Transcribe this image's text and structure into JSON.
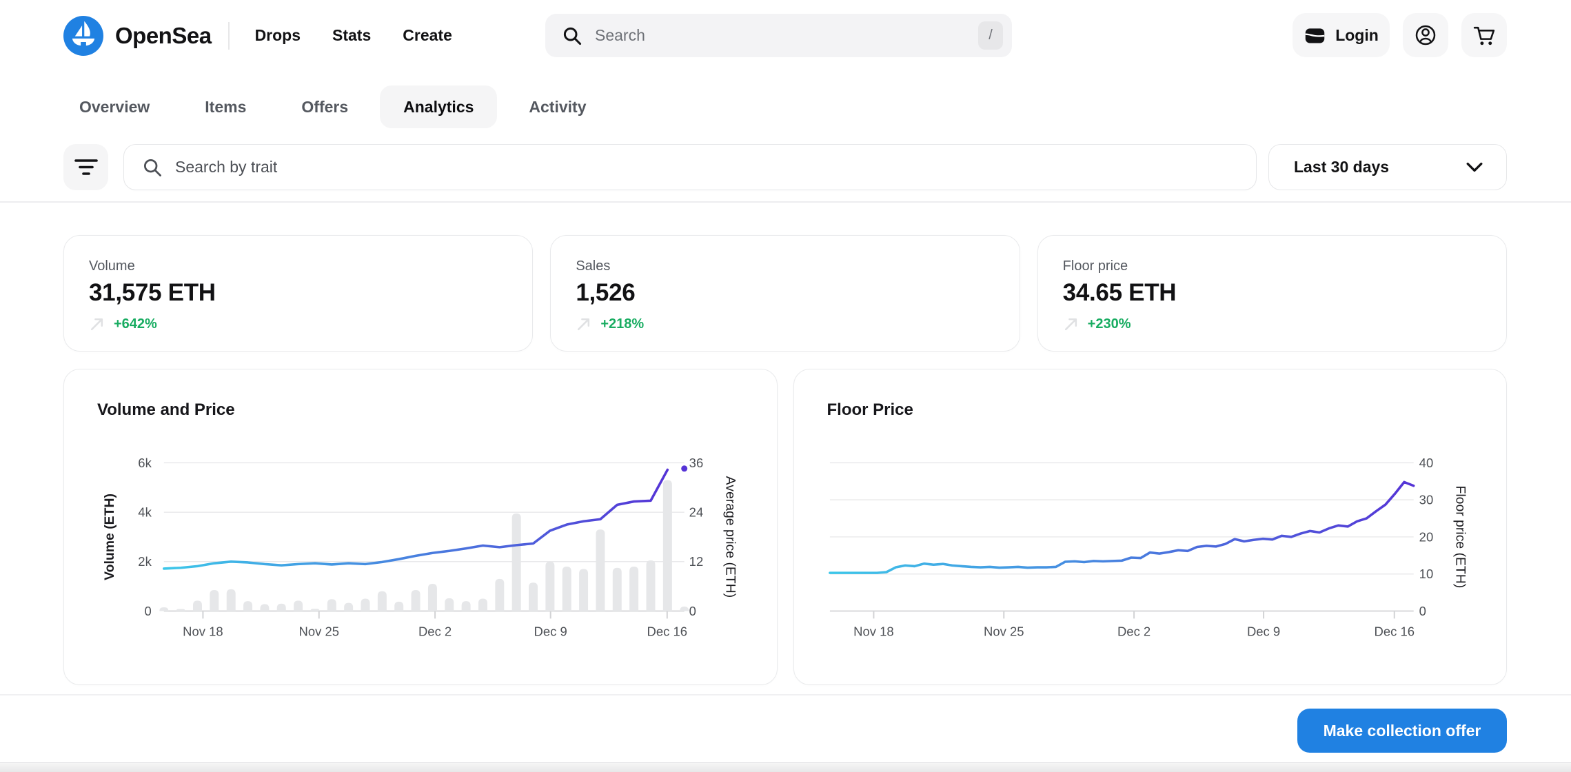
{
  "header": {
    "brand": "OpenSea",
    "nav": [
      {
        "label": "Drops"
      },
      {
        "label": "Stats"
      },
      {
        "label": "Create"
      }
    ],
    "search": {
      "placeholder": "Search",
      "shortcut": "/"
    },
    "login_label": "Login"
  },
  "tabs": [
    {
      "label": "Overview",
      "active": false
    },
    {
      "label": "Items",
      "active": false
    },
    {
      "label": "Offers",
      "active": false
    },
    {
      "label": "Analytics",
      "active": true
    },
    {
      "label": "Activity",
      "active": false
    }
  ],
  "filters": {
    "trait_search_placeholder": "Search by trait",
    "time_range": "Last 30 days"
  },
  "stats": [
    {
      "label": "Volume",
      "value": "31,575 ETH",
      "change": "+642%"
    },
    {
      "label": "Sales",
      "value": "1,526",
      "change": "+218%"
    },
    {
      "label": "Floor price",
      "value": "34.65 ETH",
      "change": "+230%"
    }
  ],
  "footer": {
    "offer_button": "Make collection offer"
  },
  "icons": {
    "logo": "opensea-boat",
    "search": "magnifier",
    "login": "wallet",
    "account": "user-circle",
    "cart": "shopping-cart",
    "filter": "filter-lines",
    "dropdown": "chevron-down",
    "change": "arrow-up-right"
  },
  "colors": {
    "accent_blue": "#2081E2",
    "green": "#18AC61",
    "bar_fill": "#e6e7e9",
    "line_gradient": [
      "#3DC7E9",
      "#4880DF",
      "#5533D6"
    ]
  },
  "chart_data": [
    {
      "type": "bar",
      "title": "Volume and Price",
      "x_ticks": [
        "Nov 18",
        "Nov 25",
        "Dec 2",
        "Dec 9",
        "Dec 16"
      ],
      "left_axis": {
        "label": "Volume (ETH)",
        "ticks": [
          "0",
          "2k",
          "4k",
          "6k"
        ],
        "range": [
          0,
          6000
        ]
      },
      "right_axis": {
        "label": "Average price (ETH)",
        "ticks": [
          "0",
          "12",
          "24",
          "36"
        ],
        "range": [
          0,
          36
        ]
      },
      "legend": "off",
      "grid": "horizontal",
      "bars": {
        "name": "Volume (ETH)",
        "axis": "left",
        "values": [
          150,
          80,
          420,
          850,
          880,
          400,
          280,
          300,
          420,
          90,
          480,
          330,
          500,
          800,
          380,
          850,
          1100,
          520,
          400,
          500,
          1300,
          3950,
          1150,
          2000,
          1800,
          1700,
          3300,
          1750,
          1800,
          2050,
          5300,
          180
        ]
      },
      "line": {
        "name": "Average price (ETH)",
        "axis": "right",
        "end_dot": true,
        "values": [
          10.3,
          10.5,
          10.9,
          11.6,
          12.0,
          11.8,
          11.4,
          11.1,
          11.4,
          11.6,
          11.3,
          11.6,
          11.4,
          11.9,
          12.6,
          13.4,
          14.1,
          14.6,
          15.2,
          15.9,
          15.5,
          16.0,
          16.4,
          19.5,
          21.0,
          21.8,
          22.3,
          25.8,
          26.6,
          26.8,
          34.3,
          34.6
        ]
      }
    },
    {
      "type": "line",
      "title": "Floor Price",
      "x_ticks": [
        "Nov 18",
        "Nov 25",
        "Dec 2",
        "Dec 9",
        "Dec 16"
      ],
      "right_axis": {
        "label": "Floor price (ETH)",
        "ticks": [
          "0",
          "10",
          "20",
          "30",
          "40"
        ],
        "range": [
          0,
          40
        ]
      },
      "legend": "off",
      "grid": "horizontal",
      "line": {
        "name": "Floor price (ETH)",
        "axis": "right",
        "end_dot": false,
        "values": [
          10.3,
          10.3,
          10.3,
          10.3,
          10.3,
          10.3,
          10.5,
          11.8,
          12.3,
          12.1,
          12.8,
          12.5,
          12.7,
          12.3,
          12.1,
          11.9,
          11.8,
          11.9,
          11.7,
          11.8,
          11.9,
          11.7,
          11.8,
          11.8,
          11.9,
          13.3,
          13.4,
          13.2,
          13.5,
          13.4,
          13.5,
          13.6,
          14.4,
          14.3,
          15.8,
          15.5,
          15.9,
          16.4,
          16.2,
          17.3,
          17.6,
          17.4,
          18.1,
          19.4,
          18.8,
          19.2,
          19.5,
          19.3,
          20.3,
          20.0,
          20.9,
          21.6,
          21.2,
          22.3,
          23.1,
          22.8,
          24.2,
          25.0,
          26.9,
          28.7,
          31.6,
          34.8,
          33.8
        ]
      }
    }
  ]
}
